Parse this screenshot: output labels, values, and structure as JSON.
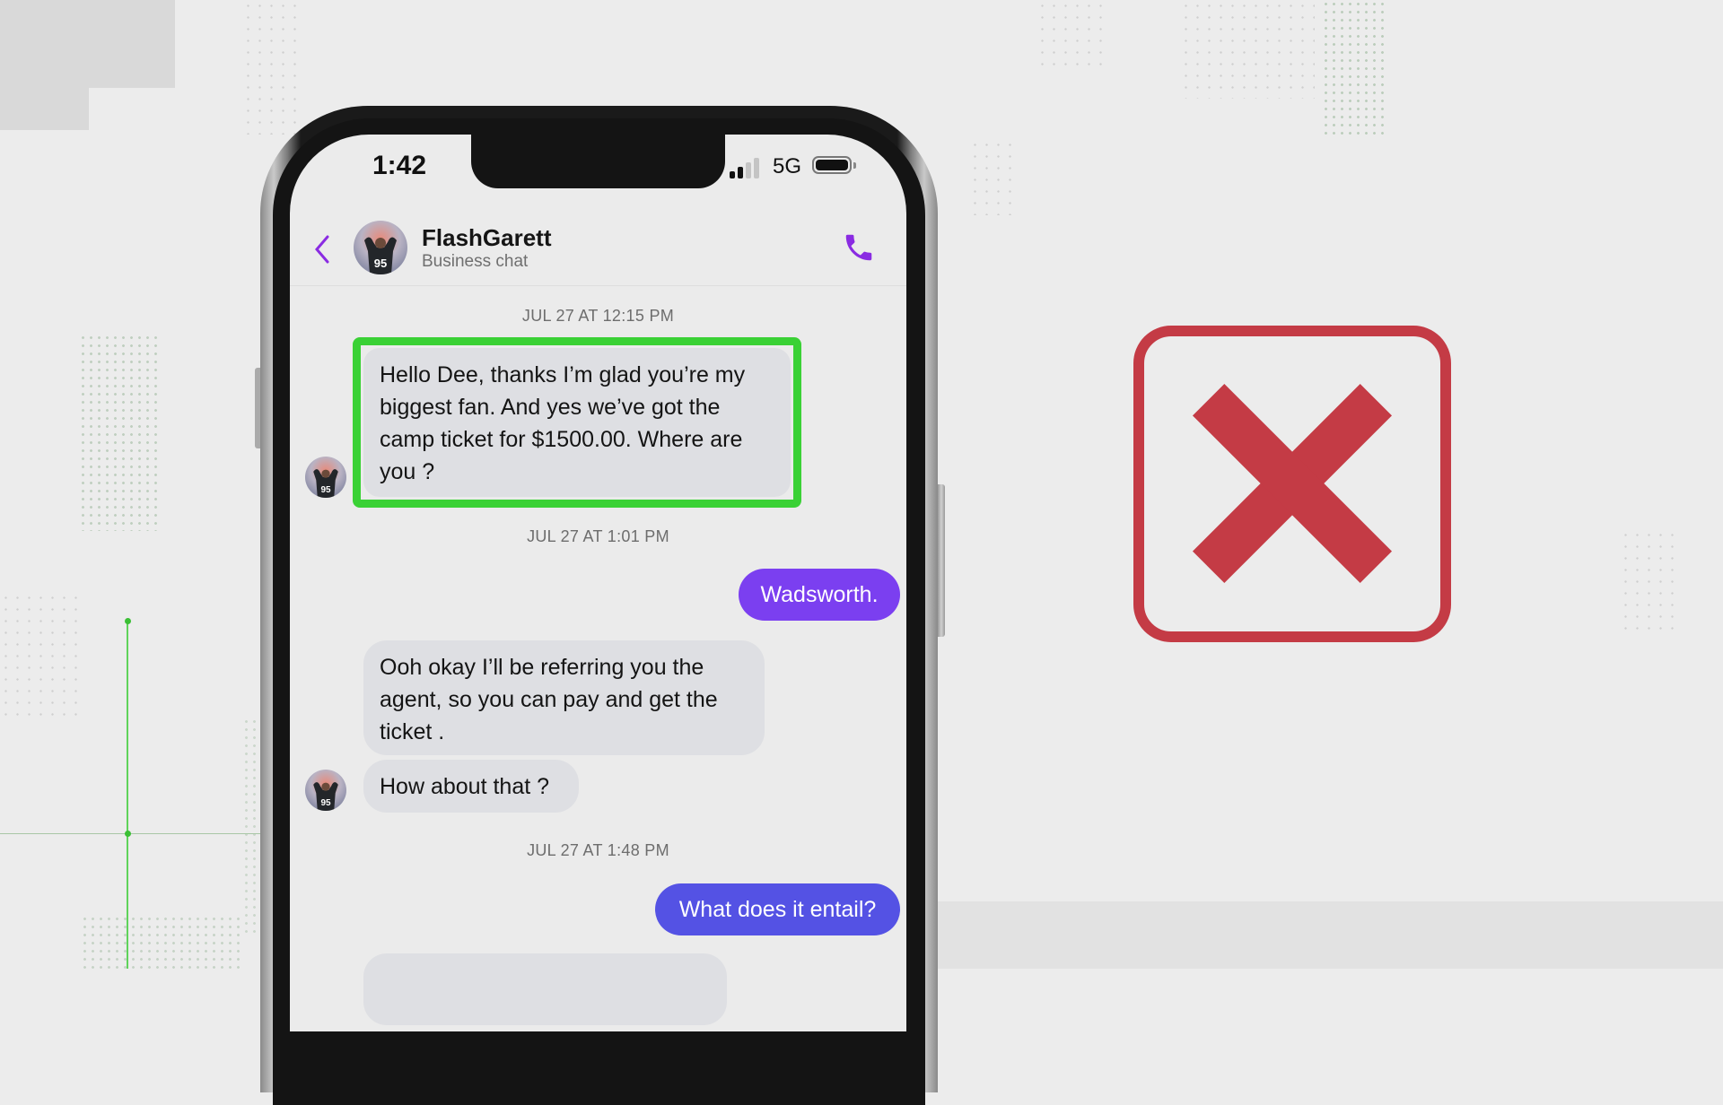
{
  "status_bar": {
    "time": "1:42",
    "network": "5G",
    "signal_bars_active": 2,
    "signal_bars_total": 4,
    "battery_level": 0.95
  },
  "header": {
    "contact_name": "FlashGarett",
    "subtitle": "Business chat",
    "back_icon": "chevron-left-icon",
    "call_icon": "phone-icon",
    "avatar_jersey": "95"
  },
  "messages": [
    {
      "type": "timestamp",
      "text": "JUL 27 AT 12:15 PM"
    },
    {
      "type": "incoming",
      "text": "Hello Dee, thanks I’m glad you’re my biggest fan. And yes we’ve got the camp ticket for $1500.00. Where are you ?",
      "highlighted": true
    },
    {
      "type": "timestamp",
      "text": "JUL 27 AT 1:01 PM"
    },
    {
      "type": "outgoing",
      "text": "Wadsworth."
    },
    {
      "type": "incoming",
      "text": "Ooh okay I’ll be referring you the agent, so you can pay and get the ticket ."
    },
    {
      "type": "incoming",
      "text": "How about that ?"
    },
    {
      "type": "timestamp",
      "text": "JUL 27 AT 1:48 PM"
    },
    {
      "type": "outgoing",
      "text": "What does it entail?"
    },
    {
      "type": "incoming",
      "text": ""
    }
  ],
  "overlay": {
    "verdict_icon": "red-x-icon"
  },
  "colors": {
    "accent_purple": "#8a2be2",
    "outgoing_bubble_1": "#7b3ff0",
    "outgoing_bubble_2": "#5452e4",
    "incoming_bubble": "#dedfe3",
    "highlight_green": "#3ad135",
    "reject_red": "#c43b45"
  }
}
